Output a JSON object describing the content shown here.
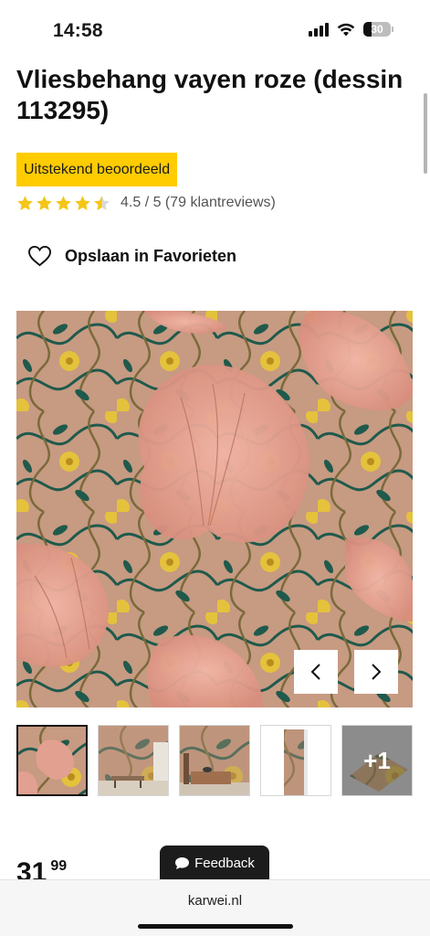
{
  "status_bar": {
    "time": "14:58",
    "battery_level": "30",
    "icons": [
      "cellular-signal-icon",
      "wifi-icon",
      "battery-icon"
    ]
  },
  "product": {
    "title": "Vliesbehang vayen roze (dessin 113295)",
    "rating_badge": "Uitstekend beoordeeld",
    "rating_value": 4.5,
    "rating_text": "4.5 / 5 (79 klantreviews)",
    "favorites_label": "Opslaan in Favorieten",
    "price_whole": "31",
    "price_cents": "99"
  },
  "gallery": {
    "more_label": "+1",
    "prev_icon": "chevron-left-icon",
    "next_icon": "chevron-right-icon"
  },
  "feedback": {
    "label": "Feedback",
    "icon": "chat-bubble-icon"
  },
  "browser": {
    "url": "karwei.nl"
  },
  "colors": {
    "accent_yellow": "#ffcc00",
    "star_yellow": "#f5c518",
    "wallpaper_base": "#c79a82",
    "wallpaper_petal": "#e8a99a",
    "wallpaper_leaf": "#1f5a4c",
    "wallpaper_flower": "#e4c23c"
  }
}
